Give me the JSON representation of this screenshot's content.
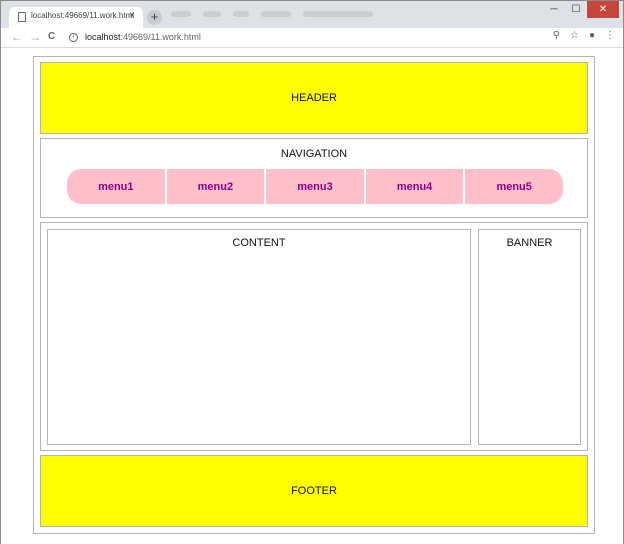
{
  "browser": {
    "tab_title": "localhost:49669/11.work.html",
    "tab_close": "×",
    "new_tab": "+",
    "url_host": "localhost",
    "url_path": ":49669/11.work.html",
    "back": "←",
    "forward": "→",
    "reload": "C",
    "info": "i",
    "minimize": "─",
    "maximize": "☐",
    "close": "✕",
    "zoom_icon": "⚲",
    "star_icon": "☆",
    "account_icon": "●",
    "menu_icon": "⋮"
  },
  "page": {
    "header": "HEADER",
    "navigation_title": "NAVIGATION",
    "menu": [
      "menu1",
      "menu2",
      "menu3",
      "menu4",
      "menu5"
    ],
    "content_title": "CONTENT",
    "banner_title": "BANNER",
    "footer": "FOOTER"
  },
  "colors": {
    "header_bg": "#ffff00",
    "footer_bg": "#ffff00",
    "menu_bg": "#ffc0cb",
    "menu_text": "#8b008b",
    "border": "#b4b4b4"
  }
}
